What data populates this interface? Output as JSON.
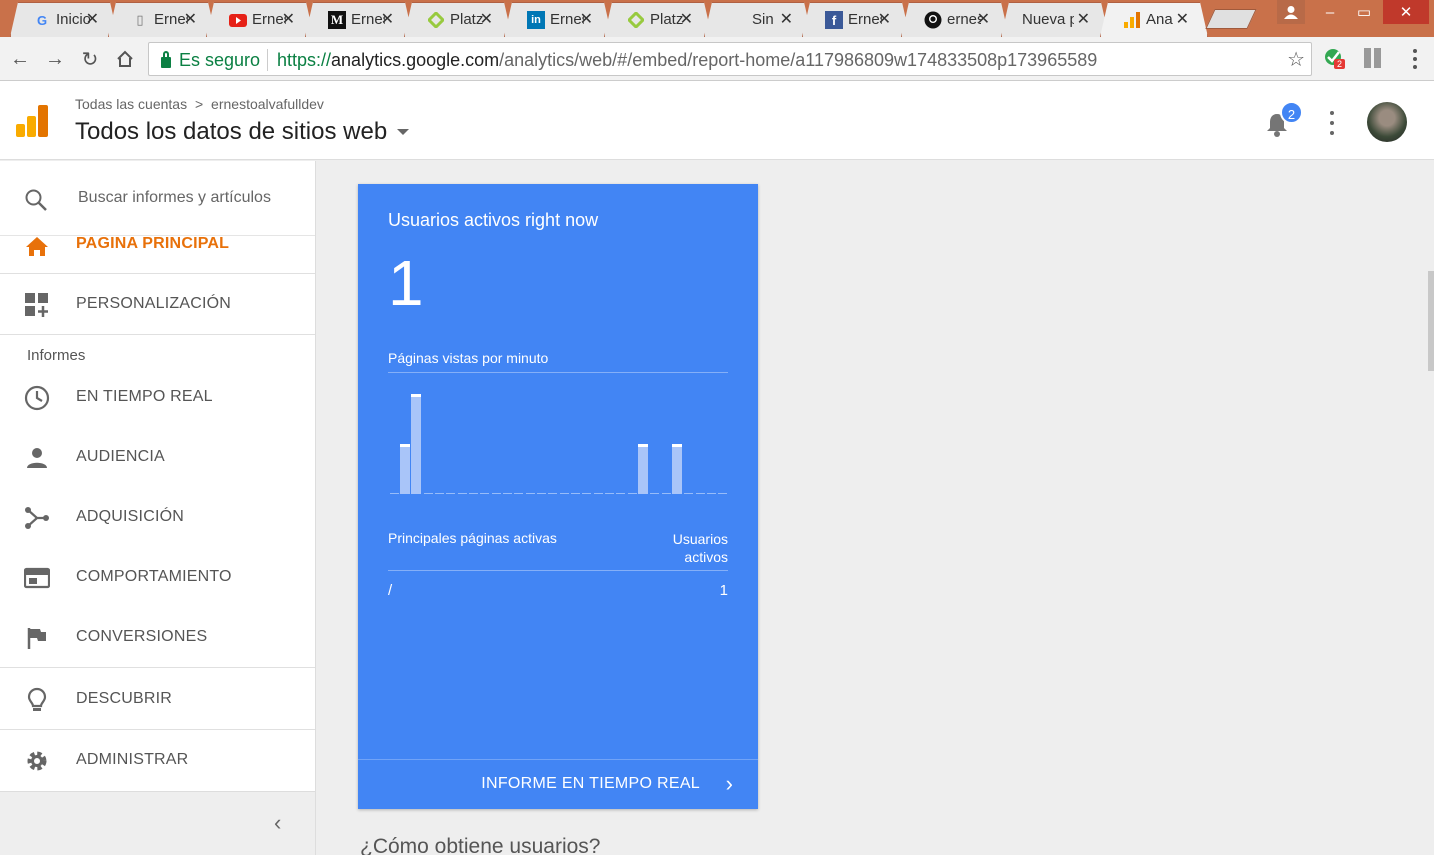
{
  "browser": {
    "tabs": [
      {
        "title": "Inicio",
        "icon": "google-icon",
        "active": false
      },
      {
        "title": "Ernesto",
        "icon": "document-icon",
        "active": false
      },
      {
        "title": "Ernesto",
        "icon": "youtube-icon",
        "active": false
      },
      {
        "title": "Ernesto",
        "icon": "medium-icon",
        "active": false
      },
      {
        "title": "Platzi",
        "icon": "platzi-icon",
        "active": false
      },
      {
        "title": "Ernesto",
        "icon": "linkedin-icon",
        "active": false
      },
      {
        "title": "Platzi",
        "icon": "platzi-icon",
        "active": false
      },
      {
        "title": "Sin",
        "icon": "",
        "active": false
      },
      {
        "title": "Ernesto",
        "icon": "facebook-icon",
        "active": false
      },
      {
        "title": "ernesto",
        "icon": "github-icon",
        "active": false
      },
      {
        "title": "Nueva p",
        "icon": "",
        "active": false
      },
      {
        "title": "Ana",
        "icon": "analytics-icon",
        "active": true
      }
    ],
    "security_label": "Es seguro",
    "url_scheme": "https://",
    "url_host": "analytics.google.com",
    "url_path": "/analytics/web/#/embed/report-home/a117986809w174833508p173965589",
    "extension_badge": "2"
  },
  "header": {
    "breadcrumb_root": "Todas las cuentas",
    "breadcrumb_separator": ">",
    "breadcrumb_account": "ernestoalvafulldev",
    "property_title": "Todos los datos de sitios web",
    "notification_count": "2"
  },
  "sidebar": {
    "search_placeholder": "Buscar informes y artículos",
    "home": "PAGINA PRINCIPAL",
    "customization": "PERSONALIZACIÓN",
    "reports_section": "Informes",
    "realtime": "EN TIEMPO REAL",
    "audience": "AUDIENCIA",
    "acquisition": "ADQUISICIÓN",
    "behavior": "COMPORTAMIENTO",
    "conversions": "CONVERSIONES",
    "discover": "DESCUBRIR",
    "admin": "ADMINISTRAR"
  },
  "realtime_card": {
    "title": "Usuarios activos right now",
    "active_users": "1",
    "pageviews_label": "Páginas vistas por minuto",
    "top_pages_label": "Principales páginas activas",
    "active_users_col_line1": "Usuarios",
    "active_users_col_line2": "activos",
    "rows": [
      {
        "page": "/",
        "users": "1"
      }
    ],
    "footer_link": "INFORME EN TIEMPO REAL",
    "accent_color": "#4285f4"
  },
  "main": {
    "next_heading": "¿Cómo obtiene usuarios?"
  },
  "chart_data": {
    "type": "bar",
    "title": "Páginas vistas por minuto",
    "values": [
      0,
      1,
      2,
      0,
      0,
      0,
      0,
      0,
      0,
      0,
      0,
      0,
      0,
      0,
      0,
      0,
      0,
      0,
      0,
      0,
      0,
      0,
      1,
      0,
      0,
      1,
      0,
      0,
      0,
      0
    ]
  }
}
